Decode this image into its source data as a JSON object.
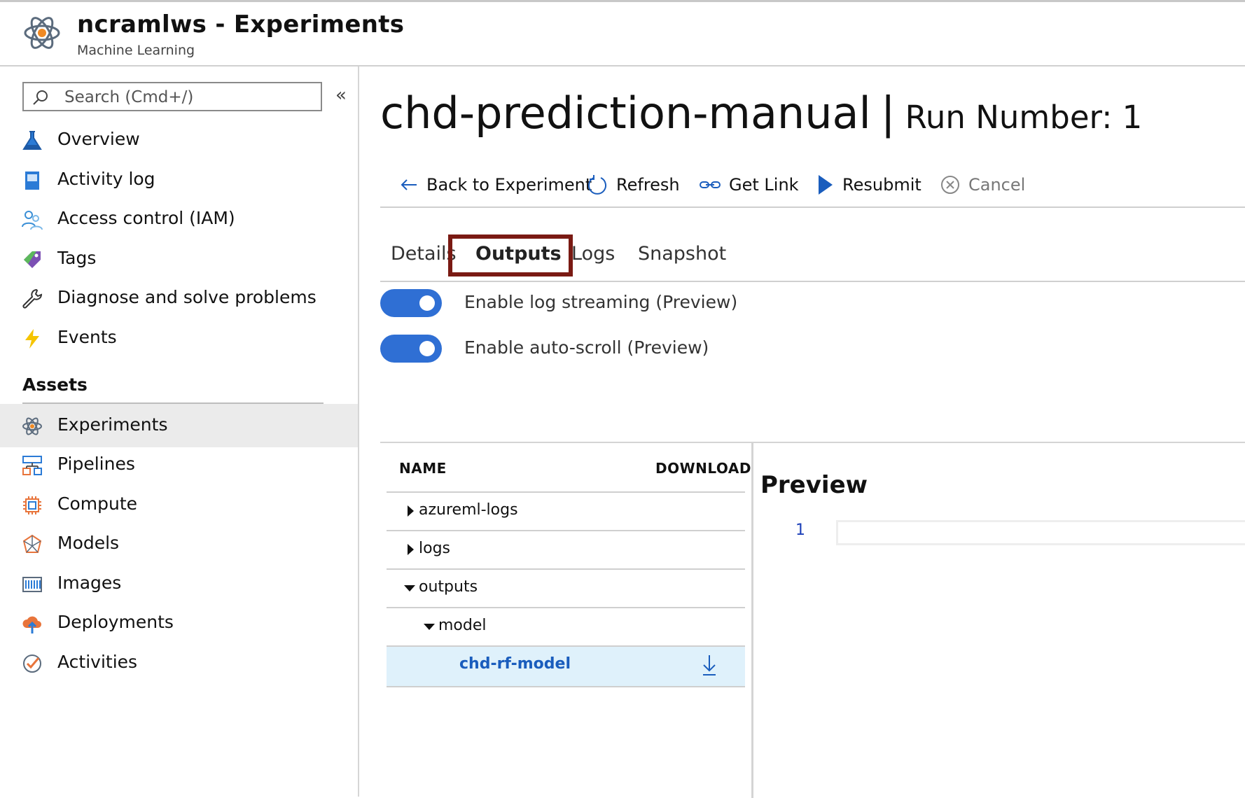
{
  "header": {
    "title": "ncramlws - Experiments",
    "subtitle": "Machine Learning",
    "logo_icon": "atom-icon"
  },
  "sidebar": {
    "search_placeholder": "Search (Cmd+/)",
    "collapse_label": "«",
    "items": [
      {
        "label": "Overview",
        "icon": "flask-icon"
      },
      {
        "label": "Activity log",
        "icon": "document-icon"
      },
      {
        "label": "Access control (IAM)",
        "icon": "people-icon"
      },
      {
        "label": "Tags",
        "icon": "tag-icon"
      },
      {
        "label": "Diagnose and solve problems",
        "icon": "wrench-icon"
      },
      {
        "label": "Events",
        "icon": "lightning-icon"
      }
    ],
    "section_title": "Assets",
    "assets": [
      {
        "label": "Experiments",
        "icon": "atom-icon",
        "active": true
      },
      {
        "label": "Pipelines",
        "icon": "pipeline-icon"
      },
      {
        "label": "Compute",
        "icon": "chip-icon"
      },
      {
        "label": "Models",
        "icon": "model-icon"
      },
      {
        "label": "Images",
        "icon": "images-icon"
      },
      {
        "label": "Deployments",
        "icon": "cloud-upload-icon"
      },
      {
        "label": "Activities",
        "icon": "check-circle-icon"
      }
    ]
  },
  "main": {
    "title": "chd-prediction-manual",
    "separator": "|",
    "run_label": "Run Number: 1",
    "toolbar": {
      "back": "Back to Experiment",
      "refresh": "Refresh",
      "get_link": "Get Link",
      "resubmit": "Resubmit",
      "cancel": "Cancel"
    },
    "tabs": [
      "Details",
      "Outputs",
      "Logs",
      "Snapshot"
    ],
    "active_tab": "Outputs",
    "toggles": [
      {
        "label": "Enable log streaming (Preview)",
        "on": true
      },
      {
        "label": "Enable auto-scroll (Preview)",
        "on": true
      }
    ],
    "files": {
      "col_name": "NAME",
      "col_download": "DOWNLOAD",
      "rows": [
        {
          "name": "azureml-logs",
          "expanded": false
        },
        {
          "name": "logs",
          "expanded": false
        },
        {
          "name": "outputs",
          "expanded": true
        },
        {
          "name": "model",
          "expanded": true
        },
        {
          "name": "chd-rf-model",
          "selected": true
        }
      ]
    },
    "preview": {
      "title": "Preview",
      "line_number": "1"
    }
  },
  "colors": {
    "accent": "#2f6fd4",
    "active_tab_highlight": "#7a1a13",
    "selected_row": "#dff1fb",
    "link": "#1a5dbd"
  }
}
